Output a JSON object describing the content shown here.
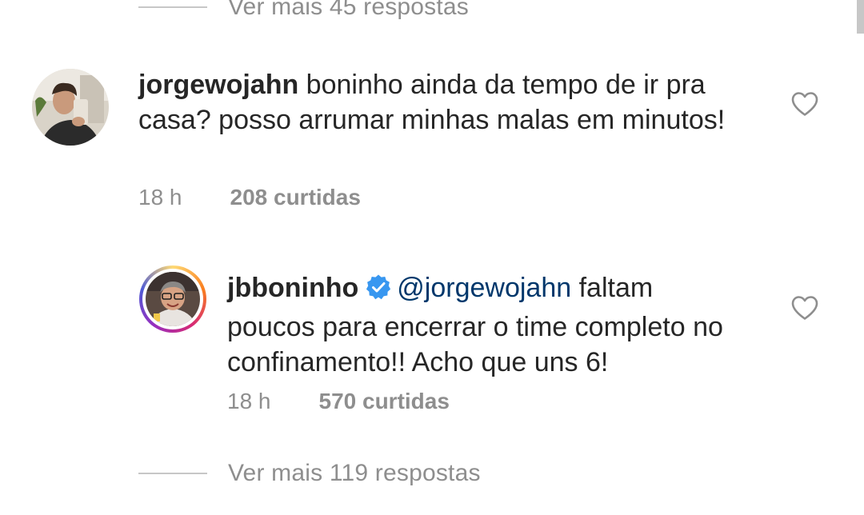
{
  "top_view_replies": {
    "text": "Ver mais 45 respostas"
  },
  "comment": {
    "username": "jorgewojahn",
    "text": " boninho ainda da tempo de ir pra casa? posso arrumar minhas malas em minutos!",
    "time": "18 h",
    "likes": "208 curtidas"
  },
  "reply": {
    "username": "jbboninho",
    "mention": "@jorgewojahn",
    "text": " faltam poucos para encerrar o time completo no confinamento!! Acho que uns 6!",
    "time": "18 h",
    "likes": "570 curtidas"
  },
  "bottom_view_replies": {
    "text": "Ver mais 119 respostas"
  },
  "colors": {
    "primary_text": "#262626",
    "secondary_text": "#8e8e8e",
    "mention": "#00376b",
    "verified": "#3897f0",
    "divider": "#c7c7c7"
  },
  "icons": {
    "verified": "verified-badge-icon",
    "like": "heart-outline-icon"
  }
}
